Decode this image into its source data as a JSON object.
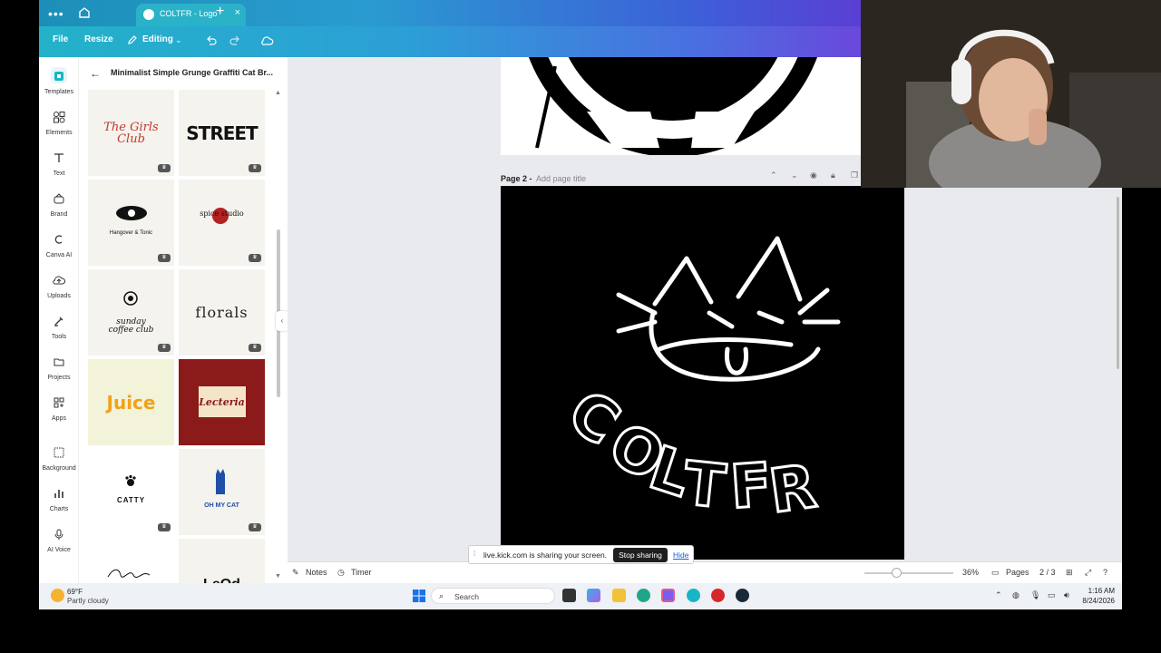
{
  "browser": {
    "tab_title": "COLTFR - Logo",
    "new_tab": "+",
    "close_tab": "×",
    "menu_dots": "•••"
  },
  "toolbar": {
    "file": "File",
    "resize": "Resize",
    "editing": "Editing"
  },
  "rail": {
    "items": [
      {
        "label": "Templates",
        "icon": "templates-icon"
      },
      {
        "label": "Elements",
        "icon": "elements-icon"
      },
      {
        "label": "Text",
        "icon": "text-icon"
      },
      {
        "label": "Brand",
        "icon": "brand-icon"
      },
      {
        "label": "Canva AI",
        "icon": "canva-ai-icon"
      },
      {
        "label": "Uploads",
        "icon": "uploads-icon"
      },
      {
        "label": "Tools",
        "icon": "tools-icon"
      },
      {
        "label": "Projects",
        "icon": "projects-icon"
      },
      {
        "label": "Apps",
        "icon": "apps-icon"
      },
      {
        "label": "Background",
        "icon": "background-icon"
      },
      {
        "label": "Charts",
        "icon": "charts-icon"
      },
      {
        "label": "AI Voice",
        "icon": "ai-voice-icon"
      }
    ]
  },
  "panel": {
    "title": "Minimalist Simple Grunge Graffiti Cat Br...",
    "templates": [
      {
        "text": "The Girls Club",
        "color": "#c0392b",
        "bg": "#f4f3ee"
      },
      {
        "text": "STREET",
        "color": "#111111",
        "bg": "#f4f3ee"
      },
      {
        "text": "Hangover & Tonic",
        "color": "#111111",
        "bg": "#f4f3ee"
      },
      {
        "text": "spice studio",
        "color": "#b22222",
        "bg": "#f4f3ee"
      },
      {
        "text": "sunday coffee club",
        "color": "#111111",
        "bg": "#f4f3ee"
      },
      {
        "text": "florals",
        "color": "#222222",
        "bg": "#f4f3ee"
      },
      {
        "text": "Juice",
        "color": "#f0a21a",
        "bg": "#f2f3d8"
      },
      {
        "text": "Lecteria",
        "color": "#8b1a1a",
        "bg": "#8b1a1a"
      },
      {
        "text": "CATTY",
        "color": "#111111",
        "bg": "#ffffff"
      },
      {
        "text": "OH MY CAT",
        "color": "#1f4fa8",
        "bg": "#f4f3ee"
      },
      {
        "text": "",
        "color": "#111111",
        "bg": "#ffffff"
      },
      {
        "text": "LeOd",
        "color": "#111111",
        "bg": "#f4f3ee"
      }
    ]
  },
  "canvas": {
    "page2_label": "Page 2 -",
    "page2_title_placeholder": "Add page title",
    "logo_text": "COLTFR"
  },
  "footer": {
    "notes": "Notes",
    "timer": "Timer",
    "zoom": "36%",
    "pages": "Pages",
    "page_count": "2 / 3"
  },
  "share_bar": {
    "message": "live.kick.com is sharing your screen.",
    "stop": "Stop sharing",
    "hide": "Hide"
  },
  "taskbar": {
    "temp": "69°F",
    "condition": "Partly cloudy",
    "search": "Search",
    "time": "1:16 AM",
    "date": "8/24/2026"
  }
}
